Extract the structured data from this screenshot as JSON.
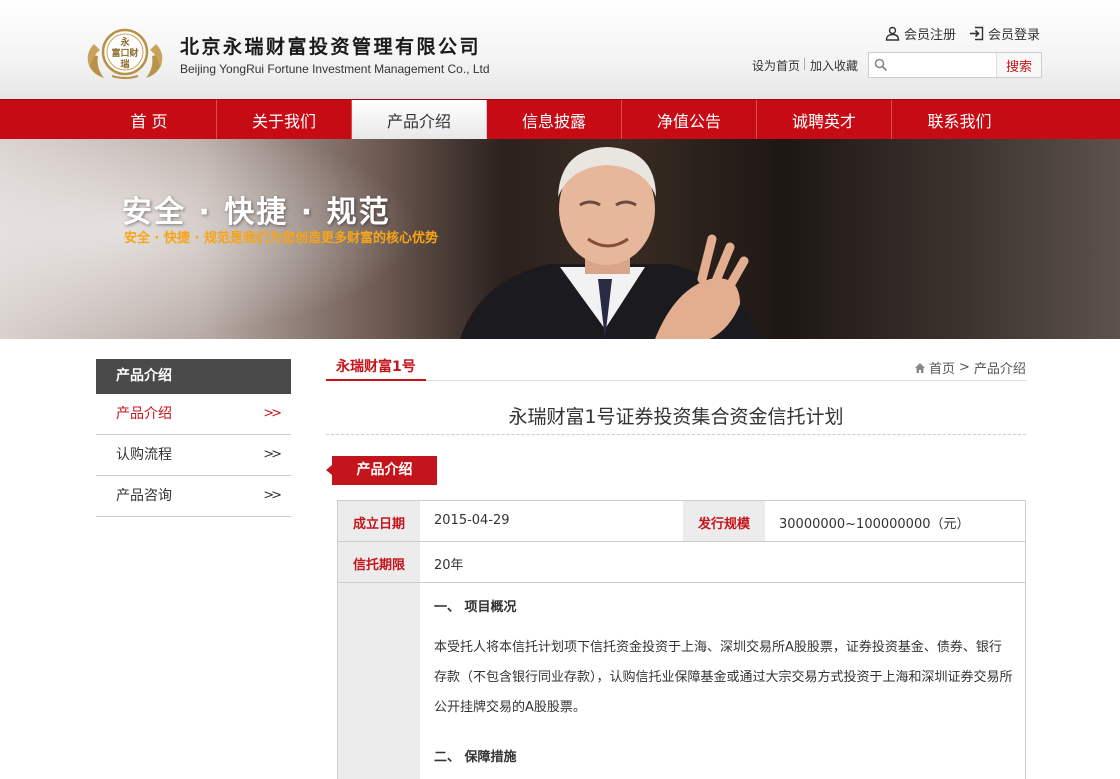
{
  "header": {
    "logo": {
      "emblem_text": "永富口财瑞",
      "name_cn": "北京永瑞财富投资管理有限公司",
      "name_en": "Beijing YongRui Fortune Investment Management Co., Ltd"
    },
    "top_links": {
      "register": "会员注册",
      "login": "会员登录"
    },
    "quick_links": {
      "set_home": "设为首页",
      "favorite": "加入收藏"
    },
    "search": {
      "placeholder": "",
      "button": "搜索"
    }
  },
  "nav": {
    "items": [
      {
        "label": "首 页"
      },
      {
        "label": "关于我们"
      },
      {
        "label": "产品介绍"
      },
      {
        "label": "信息披露"
      },
      {
        "label": "净值公告"
      },
      {
        "label": "诚聘英才"
      },
      {
        "label": "联系我们"
      }
    ],
    "active_index": 2
  },
  "banner": {
    "title": "安全 · 快捷 · 规范",
    "subtitle": "安全 · 快捷 · 规范是我们为您创造更多财富的核心优势"
  },
  "sidebar": {
    "title": "产品介绍",
    "arrow": ">>",
    "items": [
      {
        "label": "产品介绍"
      },
      {
        "label": "认购流程"
      },
      {
        "label": "产品咨询"
      }
    ]
  },
  "content": {
    "tab": "永瑞财富1号",
    "breadcrumb": {
      "home": "首页",
      "sep": ">",
      "current": "产品介绍"
    },
    "title": "永瑞财富1号证券投资集合资金信托计划",
    "section_tag": "产品介绍",
    "table": {
      "established_label": "成立日期",
      "established_value": "2015-04-29",
      "scale_label": "发行规模",
      "scale_value": "30000000~100000000（元）",
      "term_label": "信托期限",
      "term_value": "20年"
    },
    "overview_heading": "一、 项目概况",
    "overview_text": "本受托人将本信托计划项下信托资金投资于上海、深圳交易所A股股票，证券投资基金、债券、银行存款（不包含银行同业存款），认购信托业保障基金或通过大宗交易方式投资于上海和深圳证券交易所公开挂牌交易的A股股票。",
    "guarantee_heading": "二、 保障措施"
  },
  "colors": {
    "brand_red": "#c70b14",
    "accent_red": "#c4151c",
    "banner_orange": "#f7a418",
    "sidebar_dark": "#4a4a4a"
  }
}
